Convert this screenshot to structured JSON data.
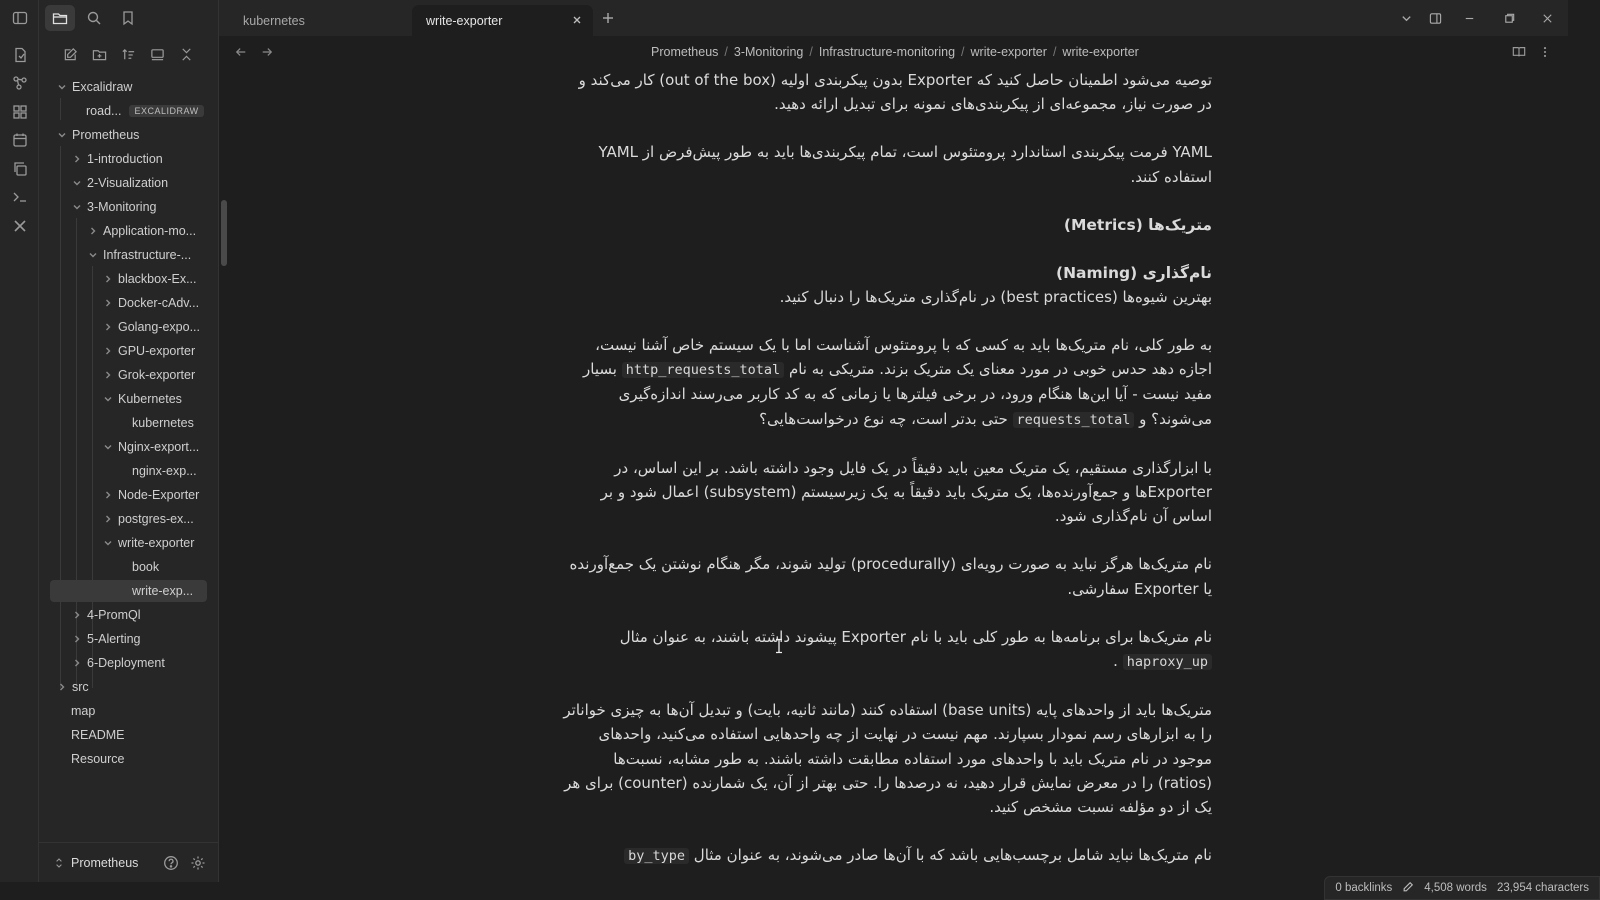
{
  "tabs": [
    {
      "label": "kubernetes",
      "active": false
    },
    {
      "label": "write-exporter",
      "active": true
    }
  ],
  "breadcrumb": [
    "Prometheus",
    "3-Monitoring",
    "Infrastructure-monitoring",
    "write-exporter",
    "write-exporter"
  ],
  "sidebar": {
    "vault_name": "Prometheus",
    "tree": {
      "excalidraw": "Excalidraw",
      "road": "road...",
      "road_badge": "EXCALIDRAW",
      "prometheus": "Prometheus",
      "introduction": "1-introduction",
      "visualization": "2-Visualization",
      "monitoring": "3-Monitoring",
      "application": "Application-mo...",
      "infrastructure": "Infrastructure-...",
      "blackbox": "blackbox-Ex...",
      "docker": "Docker-cAdv...",
      "golang": "Golang-expo...",
      "gpu": "GPU-exporter",
      "grok": "Grok-exporter",
      "kubernetes_folder": "Kubernetes",
      "kubernetes_file": "kubernetes",
      "nginx_folder": "Nginx-export...",
      "nginx_file": "nginx-exp...",
      "node": "Node-Exporter",
      "postgres": "postgres-ex...",
      "write_folder": "write-exporter",
      "book": "book",
      "write_file": "write-exp...",
      "promql": "4-PromQl",
      "alerting": "5-Alerting",
      "deployment": "6-Deployment",
      "src": "src",
      "map": "map",
      "readme": "README",
      "resource": "Resource"
    }
  },
  "content": {
    "p1": "توصیه می‌شود اطمینان حاصل کنید که Exporter بدون پیکربندی اولیه (out of the box) کار می‌کند و در صورت نیاز، مجموعه‌ای از پیکربندی‌های نمونه برای تبدیل ارائه دهید.",
    "p2": "YAML فرمت پیکربندی استاندارد پرومتئوس است، تمام پیکربندی‌ها باید به طور پیش‌فرض از YAML استفاده کنند.",
    "h_metrics": "متریک‌ها (Metrics)",
    "h_naming": "نام‌گذاری (Naming)",
    "p3": "بهترین شیوه‌ها (best practices) در نام‌گذاری متریک‌ها را دنبال کنید.",
    "p4_a": "به طور کلی، نام متریک‌ها باید به کسی که با پرومتئوس آشناست اما با یک سیستم خاص آشنا نیست، اجازه دهد حدس خوبی در مورد معنای یک متریک بزند. متریکی به نام",
    "p4_code1": "http_requests_total",
    "p4_b": "بسیار مفید نیست - آیا این‌ها هنگام ورود، در برخی فیلترها یا زمانی که به کد کاربر می‌رسند اندازه‌گیری می‌شوند؟ و",
    "p4_code2": "requests_total",
    "p4_c": "حتی بدتر است، چه نوع درخواست‌هایی؟",
    "p5": "با ابزارگذاری مستقیم، یک متریک معین باید دقیقاً در یک فایل وجود داشته باشد. بر این اساس، در Exporterها و جمع‌آورنده‌ها، یک متریک باید دقیقاً به یک زیرسیستم (subsystem) اعمال شود و بر اساس آن نام‌گذاری شود.",
    "p6": "نام متریک‌ها هرگز نباید به صورت رویه‌ای (procedurally) تولید شوند، مگر هنگام نوشتن یک جمع‌آورنده یا Exporter سفارشی.",
    "p7_a": "نام متریک‌ها برای برنامه‌ها به طور کلی باید با نام Exporter پیشوند داشته باشند، به عنوان مثال",
    "p7_code": "haproxy_up",
    "p7_b": ".",
    "p8": "متریک‌ها باید از واحدهای پایه (base units) استفاده کنند (مانند ثانیه، بایت) و تبدیل آن‌ها به چیزی خواناتر را به ابزارهای رسم نمودار بسپارند. مهم نیست در نهایت از چه واحدهایی استفاده می‌کنید، واحدهای موجود در نام متریک باید با واحدهای مورد استفاده مطابقت داشته باشند. به طور مشابه، نسبت‌ها (ratios) را در معرض نمایش قرار دهید، نه درصدها را. حتی بهتر از آن، یک شمارنده (counter) برای هر یک از دو مؤلفه نسبت مشخص کنید.",
    "p9_a": "نام متریک‌ها نباید شامل برچسب‌هایی باشد که با آن‌ها صادر می‌شوند، به عنوان مثال",
    "p9_code": "by_type"
  },
  "status": {
    "backlinks": "0 backlinks",
    "words": "4,508 words",
    "chars": "23,954 characters"
  }
}
